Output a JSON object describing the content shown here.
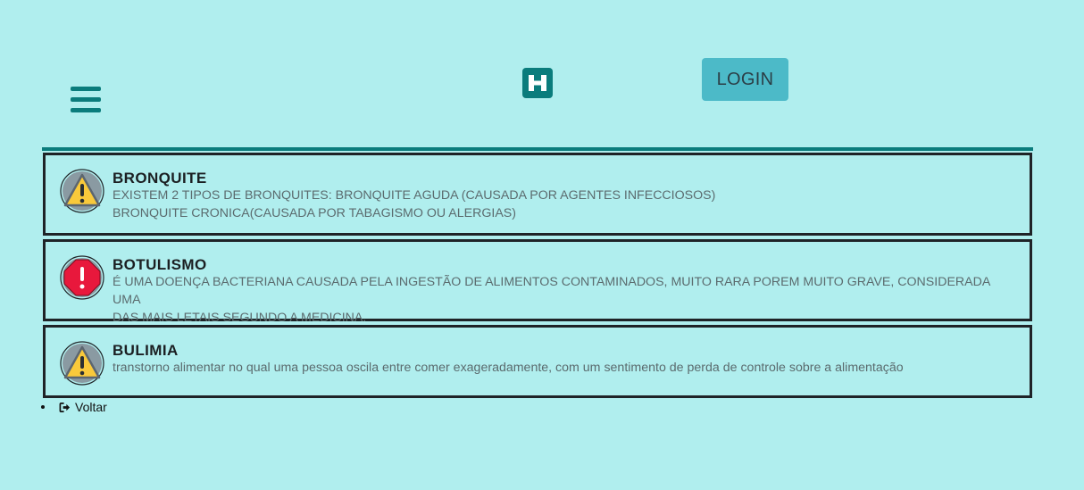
{
  "header": {
    "menu_icon": "hamburger-icon",
    "logo_icon": "hospital-h-icon",
    "login_label": "LOGIN"
  },
  "diseases": [
    {
      "icon": "warning-triangle-icon",
      "title": "BRONQUITE",
      "lines": [
        "EXISTEM 2 TIPOS DE BRONQUITES: BRONQUITE AGUDA (CAUSADA POR AGENTES INFECCIOSOS)",
        "BRONQUITE CRONICA(CAUSADA POR TABAGISMO OU ALERGIAS)"
      ]
    },
    {
      "icon": "danger-octagon-icon",
      "title": "BOTULISMO",
      "lines": [
        "É UMA DOENÇA BACTERIANA CAUSADA PELA INGESTÃO DE ALIMENTOS CONTAMINADOS, MUITO RARA POREM MUITO GRAVE, CONSIDERADA UMA",
        "DAS MAIS LETAIS SEGUNDO A MEDICINA."
      ]
    },
    {
      "icon": "warning-triangle-icon",
      "title": "BULIMIA",
      "lines": [
        "transtorno alimentar no qual uma pessoa oscila entre comer exageradamente, com um sentimento de perda de controle sobre a alimentação"
      ]
    }
  ],
  "footer": {
    "back_icon": "sign-out-icon",
    "back_label": "Voltar"
  },
  "colors": {
    "background": "#b0eeee",
    "primary": "#0a7c7c",
    "login_button": "#4cbac8",
    "warning": "#f9c93b",
    "danger": "#e8183c"
  }
}
